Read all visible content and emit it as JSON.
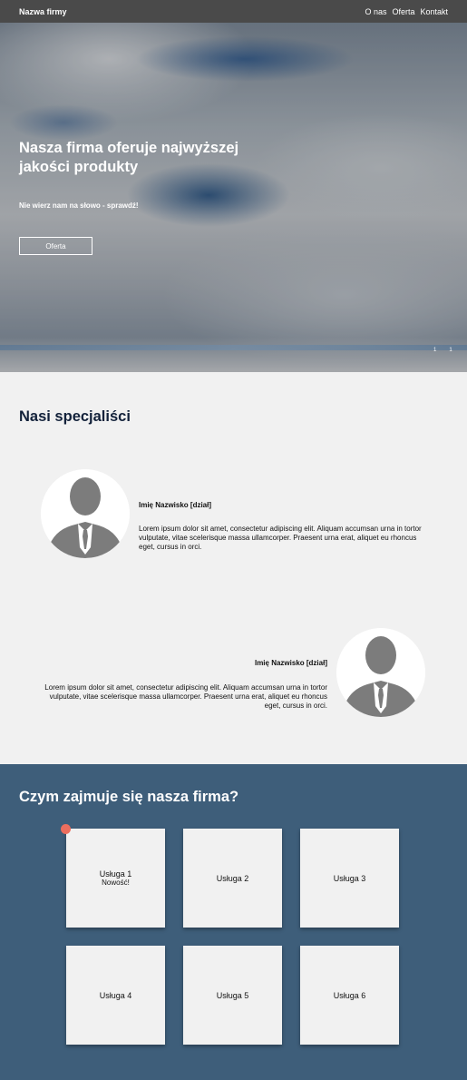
{
  "navbar": {
    "brand": "Nazwa firmy",
    "links": [
      "O nas",
      "Oferta",
      "Kontakt"
    ]
  },
  "hero": {
    "title": "Nasza firma oferuje najwyższej jakości produkty",
    "subtitle": "Nie wierz nam na słowo - sprawdź!",
    "button_label": "Oferta",
    "indicators": [
      "1",
      "1"
    ]
  },
  "specialists": {
    "title": "Nasi specjaliści",
    "people": [
      {
        "name": "Imię Nazwisko [dział]",
        "text": "Lorem ipsum dolor sit amet, consectetur adipiscing elit. Aliquam accumsan urna in tortor vulputate, vitae scelerisque massa ullamcorper. Praesent urna erat, aliquet eu rhoncus eget, cursus in orci."
      },
      {
        "name": "Imię Nazwisko [dział]",
        "text": "Lorem ipsum dolor sit amet, consectetur adipiscing elit. Aliquam accumsan urna in tortor vulputate, vitae scelerisque massa ullamcorper. Praesent urna erat, aliquet eu rhoncus eget, cursus in orci."
      }
    ]
  },
  "services": {
    "title": "Czym zajmuje się nasza firma?",
    "items": [
      {
        "label": "Usługa 1",
        "note": "Nowość!"
      },
      {
        "label": "Usługa 2"
      },
      {
        "label": "Usługa 3"
      },
      {
        "label": "Usługa 4"
      },
      {
        "label": "Usługa 5"
      },
      {
        "label": "Usługa 6"
      }
    ],
    "badge_color": "#ec6e5e",
    "background_color": "#3e5e7a"
  }
}
